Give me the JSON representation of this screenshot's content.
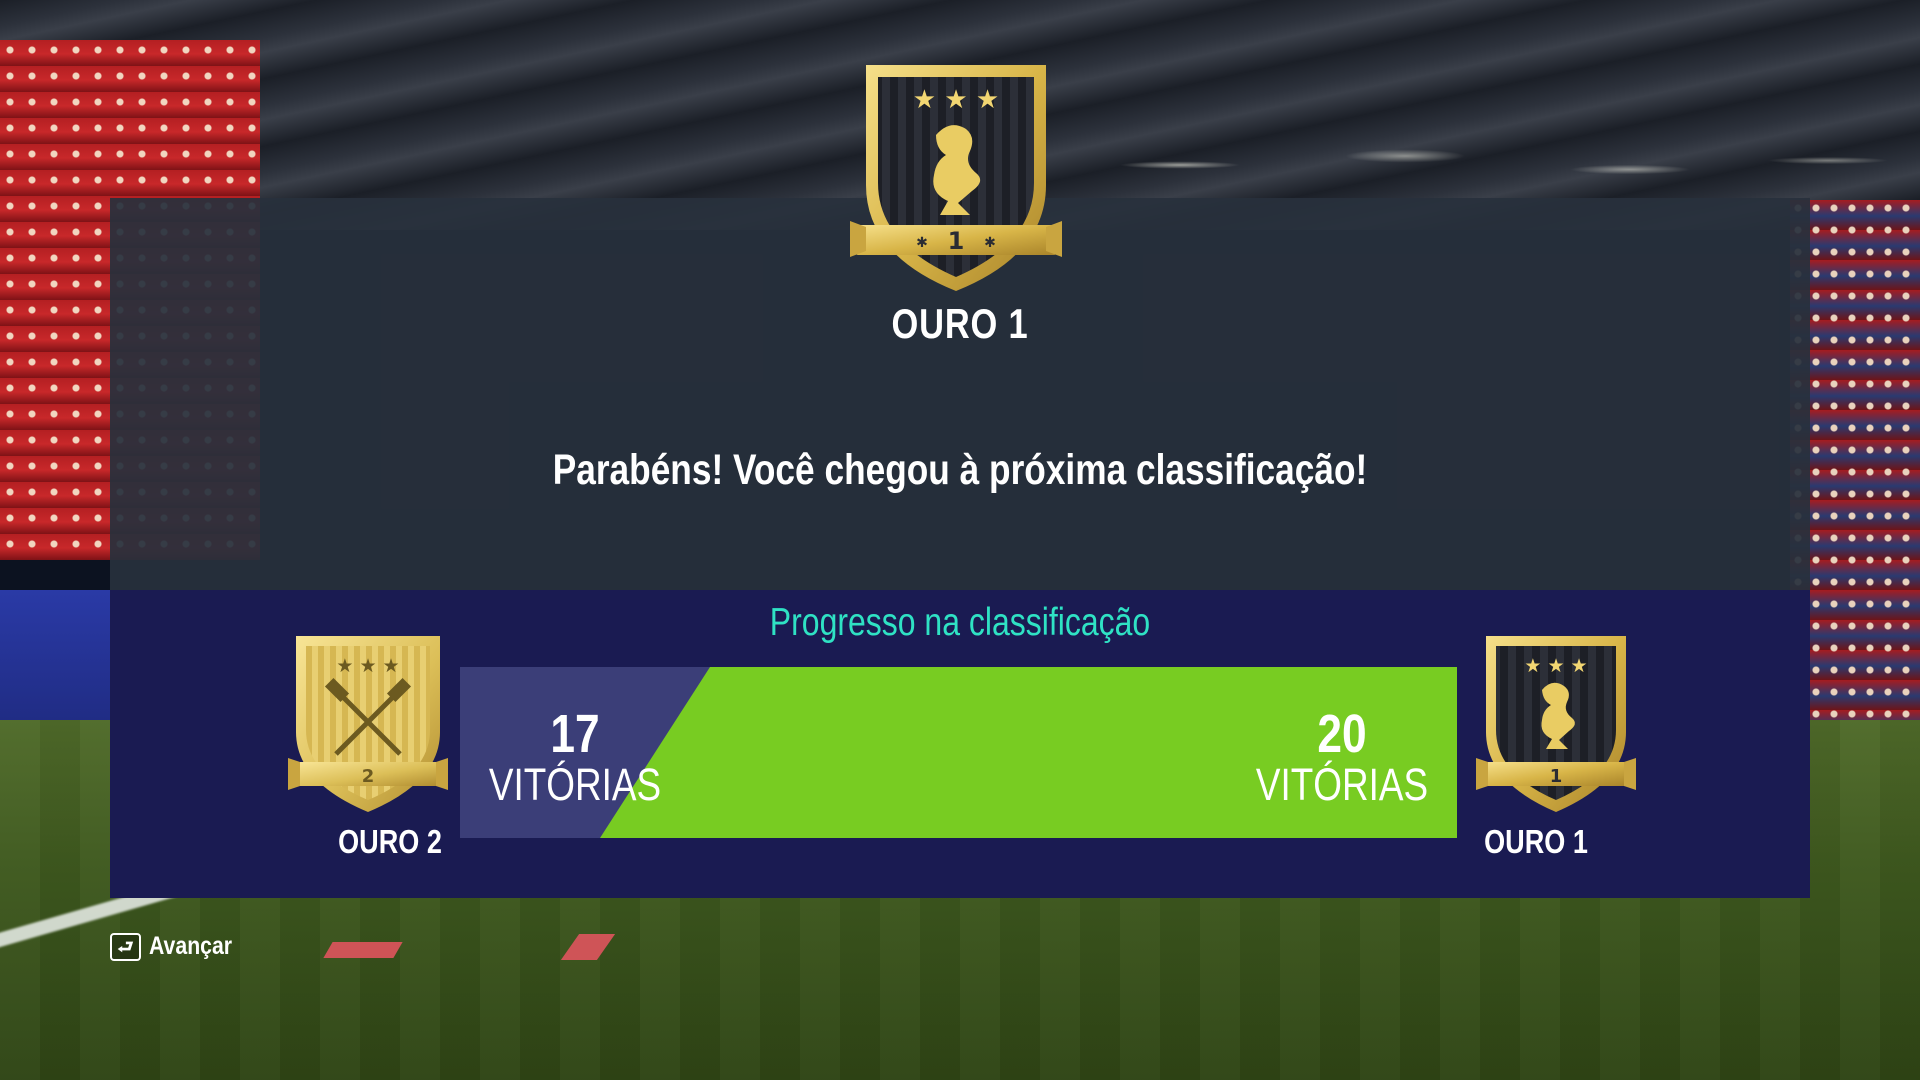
{
  "rank": {
    "current_title": "OURO 1",
    "current_badge_number": "1",
    "congrats_message": "Parabéns! Você chegou à próxima classificação!"
  },
  "progress": {
    "heading": "Progresso na classificação",
    "from": {
      "count": "17",
      "unit": "VITÓRIAS",
      "rank_label": "OURO 2",
      "badge_number": "2"
    },
    "to": {
      "count": "20",
      "unit": "VITÓRIAS",
      "rank_label": "OURO 1",
      "badge_number": "1"
    },
    "fill_fraction": 0.86
  },
  "footer": {
    "advance_label": "Avançar",
    "advance_icon": "return-key-icon"
  },
  "colors": {
    "accent_teal": "#2fe2c4",
    "progress_green": "#78cc22",
    "panel_navy": "#1a1b52",
    "gold": "#e3c45c"
  }
}
